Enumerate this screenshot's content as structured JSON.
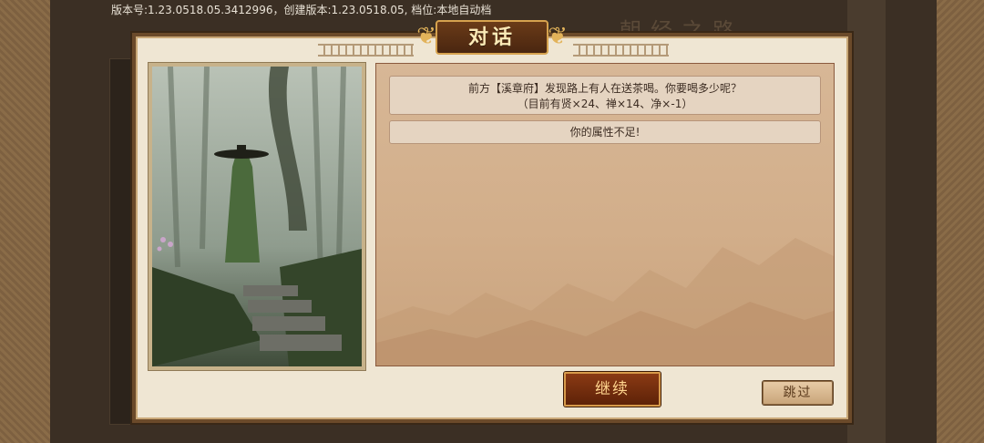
{
  "version_info": "版本号:1.23.0518.05.3412996，创建版本:1.23.0518.05, 档位:本地自动档",
  "background_title": "朝经之路",
  "dialog": {
    "title": "对话",
    "lines": [
      "前方【溪章府】发现路上有人在送茶喝。你要喝多少呢？",
      "（目前有贤×24、禅×14、净×-1）",
      "你的属性不足!"
    ]
  },
  "buttons": {
    "continue_label": "继续",
    "skip_label": "跳过"
  }
}
